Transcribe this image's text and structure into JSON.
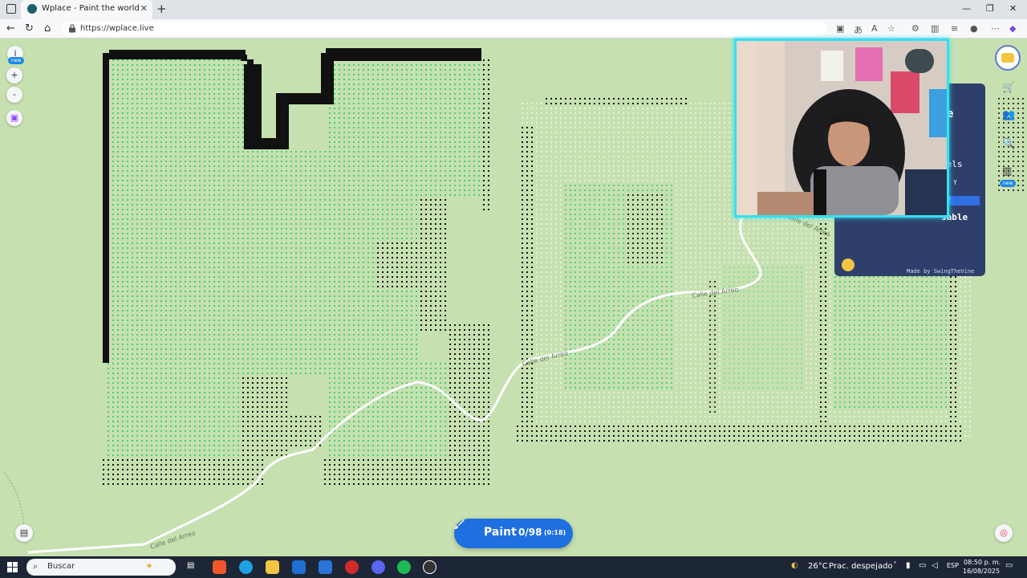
{
  "browser": {
    "tab_title": "Wplace - Paint the world",
    "url": "https://wplace.live"
  },
  "map": {
    "road_label_1": "Calle del Arreo",
    "road_label_2": "Calle del Arreo",
    "road_label_3": "Calle del Arreo",
    "road_label_4": "Calle del Arreo"
  },
  "left_controls": {
    "info_label": "i",
    "new_badge": "new",
    "zoom_in": "+",
    "zoom_out": "-"
  },
  "right_panel": {
    "made_by": "Made by SwingTheVine",
    "frag_1": "e",
    "frag_2": "xels",
    "frag_3": "Y",
    "frag_4": "sable",
    "frag_5": "e"
  },
  "right_toolbar": {
    "new_badge": "new"
  },
  "paint_button": {
    "label": "Paint",
    "count": "0/98",
    "timer": "(0:18)"
  },
  "taskbar": {
    "search_placeholder": "Buscar",
    "temperature": "26°C",
    "weather": "Prac. despejado",
    "language": "ESP",
    "time": "08:50 p. m.",
    "date": "16/08/2025"
  },
  "colors": {
    "map_bg": "#c7e0b0",
    "pixel_dark": "#111111",
    "pixel_green": "#3ed174",
    "accent_blue": "#1e6fe0",
    "webcam_border": "#35e0f0",
    "panel_bg": "#2e3f6b"
  },
  "icons": [
    "tab-favicon",
    "lock-icon",
    "brush-icon",
    "search-icon",
    "windows-start-icon"
  ]
}
